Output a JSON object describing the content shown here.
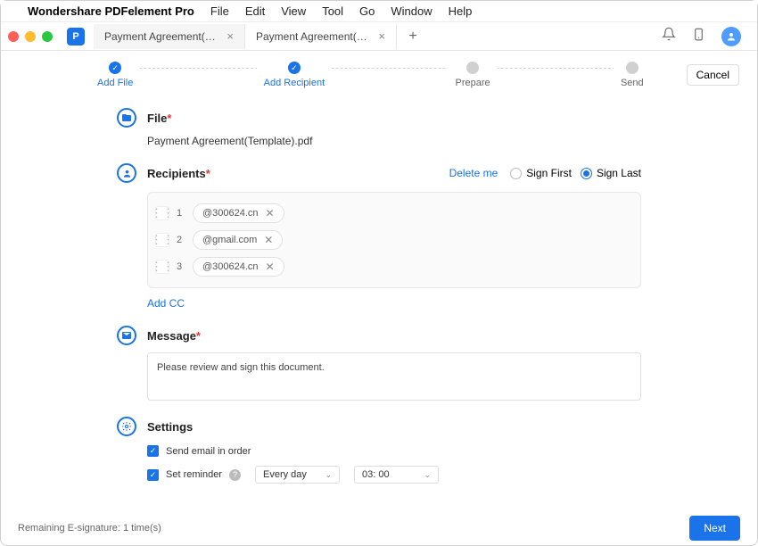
{
  "menubar": {
    "app_name": "Wondershare PDFelement Pro",
    "items": [
      "File",
      "Edit",
      "View",
      "Tool",
      "Go",
      "Window",
      "Help"
    ]
  },
  "tabs": {
    "tab1": "Payment Agreement(Tem…",
    "tab2": "Payment Agreement(Tem…"
  },
  "stepper": {
    "s1": "Add File",
    "s2": "Add Recipient",
    "s3": "Prepare",
    "s4": "Send"
  },
  "buttons": {
    "cancel": "Cancel",
    "next": "Next",
    "add_cc": "Add CC",
    "delete_me": "Delete me"
  },
  "sections": {
    "file": {
      "title": "File",
      "filename": "Payment Agreement(Template).pdf"
    },
    "recipients": {
      "title": "Recipients",
      "sign_first": "Sign First",
      "sign_last": "Sign Last",
      "sign_order_selected": "last",
      "rows": [
        {
          "num": "1",
          "email": "@300624.cn"
        },
        {
          "num": "2",
          "email": "@gmail.com"
        },
        {
          "num": "3",
          "email": "@300624.cn"
        }
      ]
    },
    "message": {
      "title": "Message",
      "text": "Please review and sign this document."
    },
    "settings": {
      "title": "Settings",
      "send_order_label": "Send email in order",
      "send_order_checked": true,
      "reminder_label": "Set reminder",
      "reminder_checked": true,
      "frequency": "Every day",
      "time": "03: 00"
    }
  },
  "footer": {
    "remaining": "Remaining E-signature: 1 time(s)"
  }
}
